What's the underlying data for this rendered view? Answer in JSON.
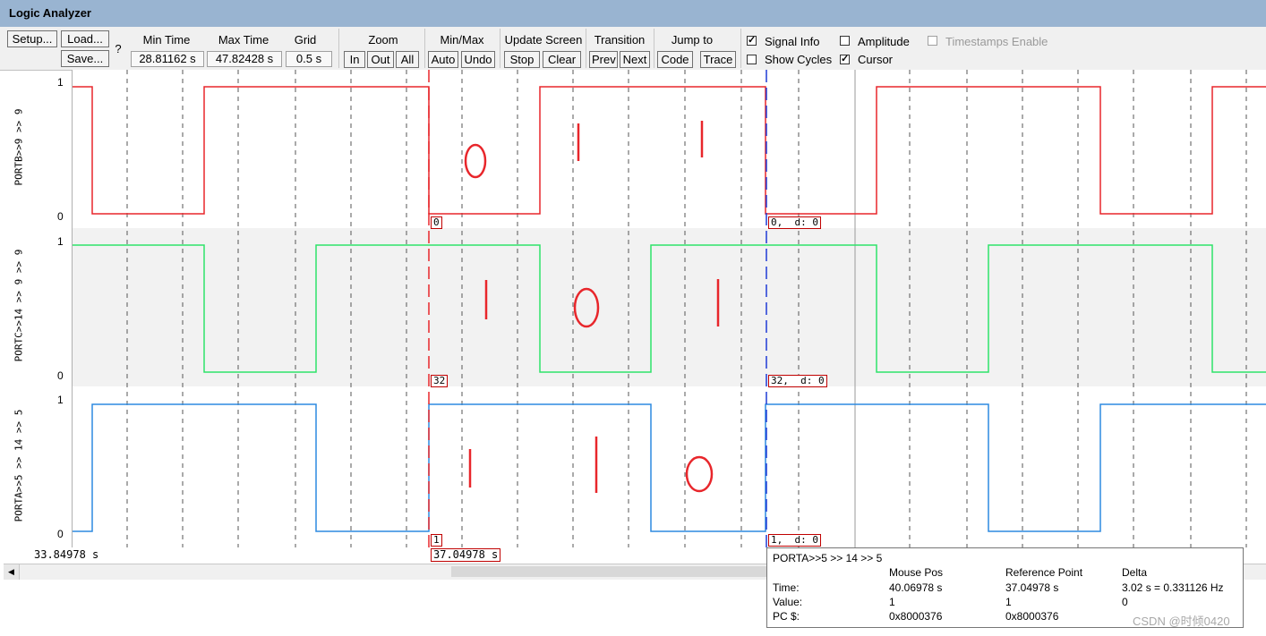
{
  "window": {
    "title": "Logic Analyzer"
  },
  "toolbar": {
    "setup": "Setup...",
    "load": "Load...",
    "save": "Save...",
    "help": "?",
    "min_time_label": "Min Time",
    "min_time_value": "28.81162 s",
    "max_time_label": "Max Time",
    "max_time_value": "47.82428 s",
    "grid_label": "Grid",
    "grid_value": "0.5 s",
    "zoom_label": "Zoom",
    "zoom_in": "In",
    "zoom_out": "Out",
    "zoom_all": "All",
    "minmax_label": "Min/Max",
    "auto": "Auto",
    "undo": "Undo",
    "update_label": "Update Screen",
    "stop": "Stop",
    "clear": "Clear",
    "transition_label": "Transition",
    "prev": "Prev",
    "next": "Next",
    "jump_label": "Jump to",
    "code": "Code",
    "trace": "Trace",
    "signal_info": {
      "label": "Signal Info",
      "checked": true
    },
    "amplitude": {
      "label": "Amplitude",
      "checked": false
    },
    "timestamps": {
      "label": "Timestamps Enable",
      "checked": false,
      "disabled": true
    },
    "show_cycles": {
      "label": "Show Cycles",
      "checked": false
    },
    "cursor": {
      "label": "Cursor",
      "checked": true
    }
  },
  "signals": [
    {
      "name": "PORTB>>9 >> 9",
      "high": "1",
      "low": "0",
      "color": "#e8262b",
      "ref_value": "0",
      "cursor_value": "0,  d: 0"
    },
    {
      "name": "PORTC>>14 >> 9 >> 9",
      "high": "1",
      "low": "0",
      "color": "#2ee36a",
      "ref_value": "32",
      "cursor_value": "32,  d: 0"
    },
    {
      "name": "PORTA>>5 >> 14 >> 5",
      "high": "1",
      "low": "0",
      "color": "#2d8ae0",
      "ref_value": "1",
      "cursor_value": "1,  d: 0"
    }
  ],
  "timeline": {
    "left_time": "33.84978 s",
    "reference_time": "37.04978 s"
  },
  "tooltip": {
    "signal": "PORTA>>5 >> 14 >> 5",
    "col_mouse": "Mouse Pos",
    "col_ref": "Reference Point",
    "col_delta": "Delta",
    "row_time": "Time:",
    "row_value": "Value:",
    "row_pc": "PC $:",
    "time_mouse": "40.06978 s",
    "time_ref": "37.04978 s",
    "time_delta": "3.02 s = 0.331126 Hz",
    "value_mouse": "1",
    "value_ref": "1",
    "value_delta": "0",
    "pc_mouse": "0x8000376",
    "pc_ref": "0x8000376"
  },
  "watermark": "CSDN @时倾0420",
  "colors": {
    "title_bar": "#99b4d1",
    "ref_cursor": "#e8262b",
    "mouse_cursor": "#1f3bd6",
    "annotation": "#e8262b"
  },
  "icons": {
    "scroll_left": "triangle-left-icon"
  }
}
